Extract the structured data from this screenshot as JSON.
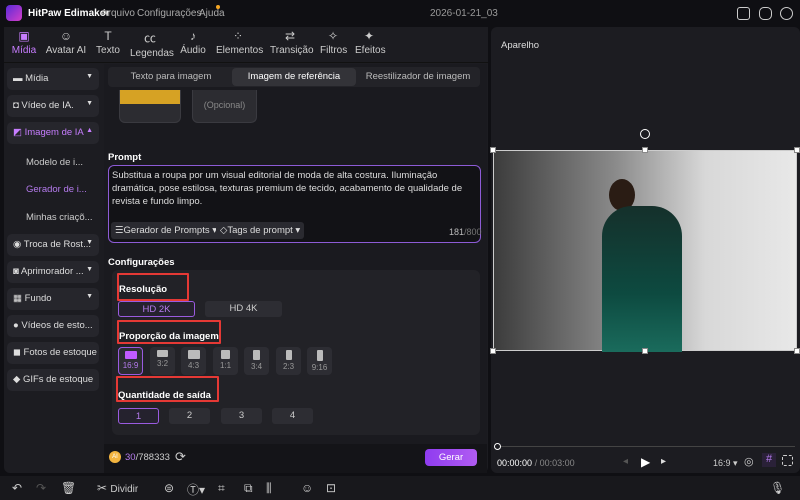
{
  "app": {
    "title": "HitPaw Edimakor",
    "menu": [
      "Arquivo",
      "Configurações",
      "Ajuda"
    ],
    "project_name": "2026-01-21_03"
  },
  "toolbar_tabs": [
    {
      "label": "Mídia",
      "icon": "media-icon",
      "active": true
    },
    {
      "label": "Avatar AI",
      "icon": "avatar-icon"
    },
    {
      "label": "Texto",
      "icon": "text-icon"
    },
    {
      "label": "Legendas",
      "icon": "captions-icon"
    },
    {
      "label": "Áudio",
      "icon": "audio-icon"
    },
    {
      "label": "Elementos",
      "icon": "elements-icon"
    },
    {
      "label": "Transição",
      "icon": "transition-icon"
    },
    {
      "label": "Filtros",
      "icon": "filters-icon"
    },
    {
      "label": "Efeitos",
      "icon": "effects-icon"
    }
  ],
  "sidebar": {
    "items": [
      "Mídia",
      "Vídeo de IA.",
      "Imagem de IA",
      "Troca de Rost...",
      "Aprimorador ...",
      "Fundo",
      "Vídeos de esto...",
      "Fotos de estoque",
      "GIFs de estoque"
    ],
    "subitems": [
      "Modelo de i...",
      "Gerador de i...",
      "Minhas criaçõ..."
    ]
  },
  "mode_tabs": [
    "Texto para imagem",
    "Imagem de referência",
    "Reestilizador de imagem"
  ],
  "active_mode": "Imagem de referência",
  "reference": {
    "optional_label": "(Opcional)"
  },
  "prompt": {
    "label": "Prompt",
    "text": "Substitua a roupa por um visual editorial de moda de alta costura. Iluminação dramática, pose estilosa, texturas premium de tecido, acabamento de qualidade de revista e fundo limpo.",
    "generator_button": "Gerador de Prompts",
    "tags_button": "Tags de prompt",
    "char_count": "181",
    "char_max": "/800"
  },
  "settings": {
    "label": "Configurações",
    "resolution": {
      "label": "Resolução",
      "options": [
        "HD 2K",
        "HD 4K"
      ],
      "selected": "HD 2K"
    },
    "ratio": {
      "label": "Proporção da imagem",
      "options": [
        "16:9",
        "3:2",
        "4:3",
        "1:1",
        "3:4",
        "2:3",
        "9:16"
      ],
      "selected": "16:9"
    },
    "quantity": {
      "label": "Quantidade de saída",
      "options": [
        "1",
        "2",
        "3",
        "4"
      ],
      "selected": "1"
    }
  },
  "footer": {
    "coin_label": "AI",
    "credits_used": "30",
    "credits_total": "/788333",
    "generate_button": "Gerar"
  },
  "preview": {
    "title": "Aparelho",
    "time_current": "00:00:00",
    "time_total": "/ 00:03:00",
    "aspect": "16:9",
    "progress": 0
  },
  "bottom_toolbar": {
    "split_label": "Dividir"
  },
  "colors": {
    "accent": "#b15cf2",
    "highlight_box": "#e53935"
  }
}
